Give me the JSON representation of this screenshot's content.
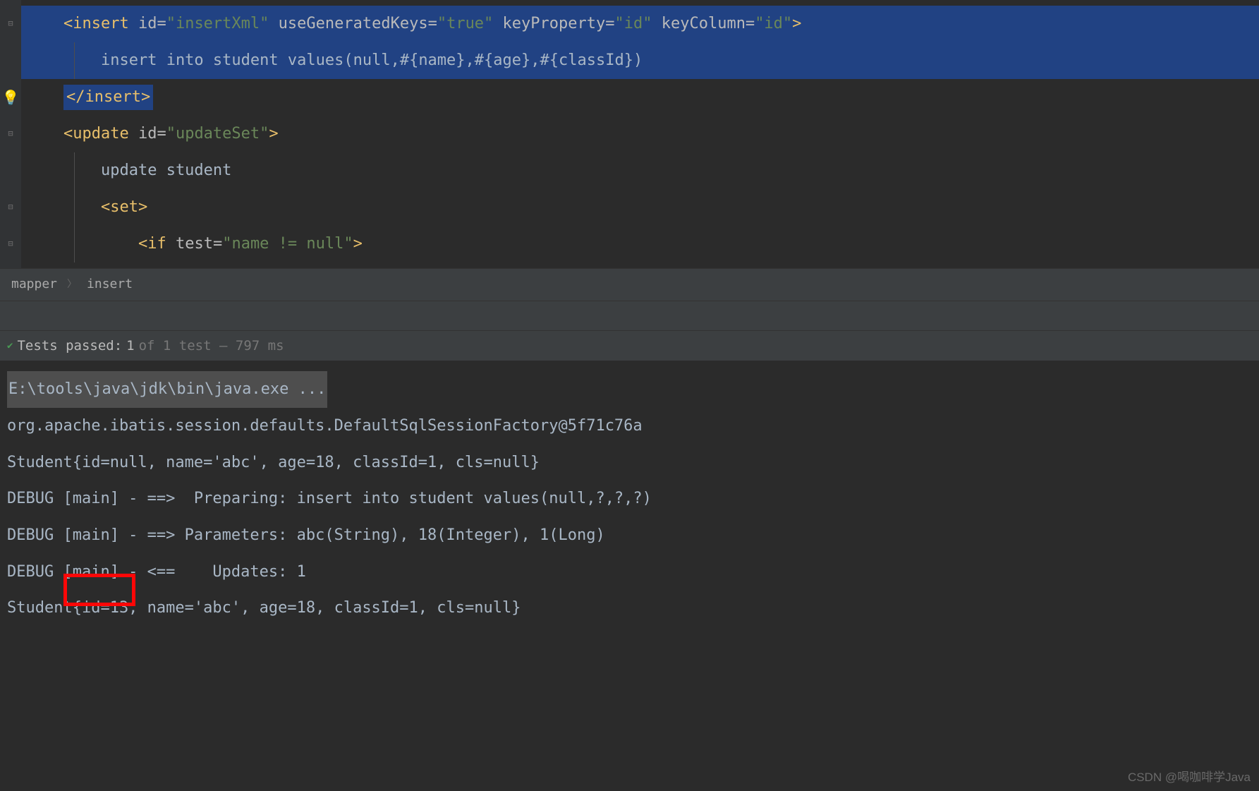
{
  "code": {
    "line1": {
      "tag_open": "<insert",
      "attr1_name": " id=",
      "attr1_val": "\"insertXml\"",
      "attr2_name": " useGeneratedKeys=",
      "attr2_val": "\"true\"",
      "attr3_name": " keyProperty=",
      "attr3_val": "\"id\"",
      "attr4_name": " keyColumn=",
      "attr4_val": "\"id\"",
      "tag_close": ">"
    },
    "line2": "    insert into student values(null,#{name},#{age},#{classId})",
    "line3": "</insert>",
    "line4": {
      "tag_open": "<update",
      "attr1_name": " id=",
      "attr1_val": "\"updateSet\"",
      "tag_close": ">"
    },
    "line5": "    update student",
    "line6_open": "    <set>",
    "line7": {
      "indent": "        ",
      "tag_open": "<if",
      "attr1_name": " test=",
      "attr1_val": "\"name != null\"",
      "tag_close": ">"
    }
  },
  "breadcrumb": {
    "item1": "mapper",
    "item2": "insert"
  },
  "test_status": {
    "label": "Tests passed:",
    "count": "1",
    "suffix": "of 1 test – 797 ms"
  },
  "console": {
    "cmd": "E:\\tools\\java\\jdk\\bin\\java.exe ...",
    "line1": "org.apache.ibatis.session.defaults.DefaultSqlSessionFactory@5f71c76a",
    "line2": "Student{id=null, name='abc', age=18, classId=1, cls=null}",
    "line3": "DEBUG [main] - ==>  Preparing: insert into student values(null,?,?,?)",
    "line4": "DEBUG [main] - ==> Parameters: abc(String), 18(Integer), 1(Long)",
    "line5": "DEBUG [main] - <==    Updates: 1",
    "line6": "Student{id=13, name='abc', age=18, classId=1, cls=null}"
  },
  "watermark": "CSDN @喝咖啡学Java"
}
